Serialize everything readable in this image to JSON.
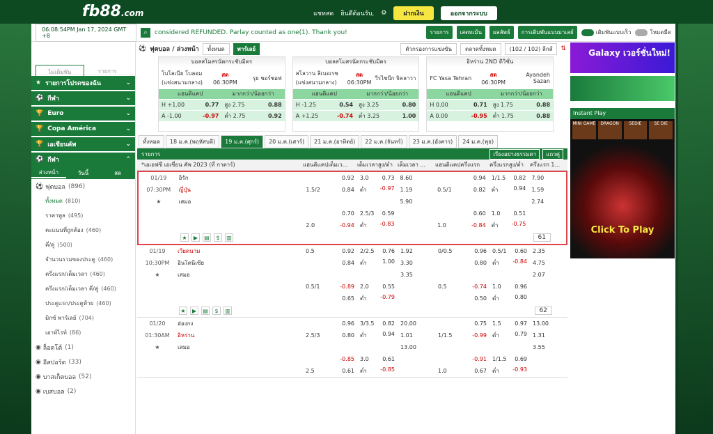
{
  "topbar": {
    "logo": "fb88",
    "logo_suffix": ".com",
    "chat": "แชทสด",
    "welcome": "ยินดีต้อนรับ,",
    "deposit": "ฝากเงิน",
    "logout": "ออกจากระบบ"
  },
  "header": {
    "time": "06:08:54PM Jan 17, 2024 GMT +8",
    "ticker": "considered REFUNDED. Parlay counted as one(1). Thank you!",
    "btn_list": "รายการ",
    "btn_bet": "เสตทเม้น",
    "btn_result": "ผลลัพธ์",
    "btn_type": "การเดิมพันแบบมาเลย์",
    "toggle1": "เดิมพันแบบเร็ว",
    "toggle2": "โหมดมืด"
  },
  "left": {
    "tab_unsettled": "ไม่เดิมพัน",
    "tab_list": "รายการ",
    "cats": [
      "รายการโปรดของฉัน",
      "กีฬา",
      "Euro",
      "Copa América",
      "เอเชียนคัพ",
      "กีฬา"
    ],
    "subtabs": [
      "ล่วงหน้า",
      "วันนี้",
      "สด"
    ],
    "items": [
      {
        "label": "ฟุตบอล",
        "count": "(896)"
      },
      {
        "label": "ทั้งหมด",
        "count": "(810)"
      },
      {
        "label": "ราคาพูล",
        "count": "(495)"
      },
      {
        "label": "คะแนนที่ถูกต้อง",
        "count": "(460)"
      },
      {
        "label": "คี่/คู่",
        "count": "(500)"
      },
      {
        "label": "จำนวนรวมของประตู",
        "count": "(460)"
      },
      {
        "label": "ครึ่งแรก/เต็มเวลา",
        "count": "(460)"
      },
      {
        "label": "ครึ่งแรก/เต็มเวลา คี่/คู่",
        "count": "(460)"
      },
      {
        "label": "ประตูแรก/ประตูท้าย",
        "count": "(460)"
      },
      {
        "label": "มิกซ์ พาร์เลย์",
        "count": "(704)"
      },
      {
        "label": "เอาท์ไรท์",
        "count": "(86)"
      },
      {
        "label": "ล็อตโต้",
        "count": "(1)"
      },
      {
        "label": "อีสปอร์ต",
        "count": "(33)"
      },
      {
        "label": "บาสเก็ตบอล",
        "count": "(52)"
      },
      {
        "label": "เบสบอล",
        "count": "(2)"
      }
    ]
  },
  "center": {
    "sport": "ฟุตบอล / ล่วงหน้า",
    "filter": "ทั้งหมด",
    "parlay": "พาร์เลย์",
    "sort": "ตัวกรองการแข่งขัน",
    "market": "ตลาดทั้งหมด",
    "count": "(102 / 102) ลีกส์",
    "featured": [
      {
        "league": "บอลสโมสรนัดกระชับมิตร",
        "home": "โบโลเนีย โบลอม (แข่งสนามกลาง)",
        "live": "สด",
        "time": "06:30PM",
        "away": "รุย ชอร์ชอฟ",
        "h1": "H +1.00",
        "h2": "0.77",
        "o1": "สูง 2.75",
        "o2": "0.88",
        "a1": "A -1.00",
        "a2": "-0.97",
        "u1": "ต่ำ 2.75",
        "u2": "0.92"
      },
      {
        "league": "บอลสโมสรนัดกระชับมิตร",
        "home": "สโลวาน ลิเบอเรช (แข่งสนามกลาง)",
        "live": "สด",
        "time": "06:30PM",
        "away": "วีรไชบีก จิคลาวา",
        "h1": "H -1.25",
        "h2": "0.54",
        "o1": "สูง 3.25",
        "o2": "0.80",
        "a1": "A +1.25",
        "a2": "-0.74",
        "u1": "ต่ำ 3.25",
        "u2": "1.00"
      },
      {
        "league": "อิหร่าน 2ND ดิวิชั่น",
        "home": "FC Yasa Tehran",
        "live": "สด",
        "time": "06:30PM",
        "away": "Ayandeh Sazan",
        "h1": "H 0.00",
        "h2": "0.71",
        "o1": "สูง 1.75",
        "o2": "0.88",
        "a1": "A 0.00",
        "a2": "-0.95",
        "u1": "ต่ำ 1.75",
        "u2": "0.88"
      }
    ],
    "hcap_label": "แฮนดิแคป",
    "ou_label": "มากกว่า/น้อยกว่า",
    "dates": [
      "ทั้งหมด",
      "18 ม.ค.(พฤหัสบดี)",
      "19 ม.ค.(ศุกร์)",
      "20 ม.ค.(เสาร์)",
      "21 ม.ค.(อาทิตย์)",
      "22 ม.ค.(จันทร์)",
      "23 ม.ค.(อังคาร)",
      "24 ม.ค.(พุธ)"
    ],
    "list_label": "รายการ",
    "order": "เรียงอย่างธรรมดา",
    "view": "แถวคู่",
    "league": "*เอเอฟซี เอเชี่ยน คัพ 2023 (ที่ กาตาร์)",
    "cols": [
      "แฮนดิแคปเต็มเว...",
      "เต็มเวลาสูง/ต่ำ",
      "เต็มเวลา ...",
      "แฮนดิแคปครึ่งแรก",
      "ครึ่งแรกสูง/ต่ำ",
      "ครึ่งแรก 1..."
    ],
    "matches": [
      {
        "date": "01/19",
        "time": "07:30PM",
        "home": "อิรัก",
        "away": "ญี่ปุ่น",
        "draw": "เสมอ",
        "home_red": false,
        "away_red": true,
        "more": "61",
        "rows": [
          [
            "",
            "0.92",
            "3.0",
            "0.73",
            "8.60",
            "",
            "0.94",
            "1/1.5",
            "0.82",
            "7.90"
          ],
          [
            "1.5/2",
            "0.84",
            "ต่ำ",
            "-0.97",
            "1.19",
            "0.5/1",
            "0.82",
            "ต่ำ",
            "0.94",
            "1.59"
          ],
          [
            "",
            "",
            "",
            "",
            "5.90",
            "",
            "",
            "",
            "",
            "2.74"
          ],
          [
            "",
            "0.70",
            "2.5/3",
            "0.59",
            "",
            "",
            "0.60",
            "1.0",
            "0.51",
            ""
          ],
          [
            "2.0",
            "-0.94",
            "ต่ำ",
            "-0.83",
            "",
            "1.0",
            "-0.84",
            "ต่ำ",
            "-0.75",
            ""
          ]
        ]
      },
      {
        "date": "01/19",
        "time": "10:30PM",
        "home": "เวียดนาม",
        "away": "อินโดนีเซีย",
        "draw": "เสมอ",
        "home_red": true,
        "away_red": false,
        "more": "62",
        "rows": [
          [
            "0.5",
            "0.92",
            "2/2.5",
            "0.76",
            "1.92",
            "0/0.5",
            "0.96",
            "0.5/1",
            "0.60",
            "2.35"
          ],
          [
            "",
            "0.84",
            "ต่ำ",
            "1.00",
            "3.30",
            "",
            "0.80",
            "ต่ำ",
            "-0.84",
            "4.75"
          ],
          [
            "",
            "",
            "",
            "",
            "3.35",
            "",
            "",
            "",
            "",
            "2.07"
          ],
          [
            "0.5/1",
            "-0.89",
            "2.0",
            "0.55",
            "",
            "0.5",
            "-0.74",
            "1.0",
            "0.96",
            ""
          ],
          [
            "",
            "0.65",
            "ต่ำ",
            "-0.79",
            "",
            "",
            "0.50",
            "ต่ำ",
            "0.80",
            ""
          ]
        ]
      },
      {
        "date": "01/20",
        "time": "01:30AM",
        "home": "ฮ่องกง",
        "away": "อิหร่าน",
        "draw": "เสมอ",
        "home_red": false,
        "away_red": true,
        "more": "",
        "rows": [
          [
            "",
            "0.96",
            "3/3.5",
            "0.82",
            "20.00",
            "",
            "0.75",
            "1.5",
            "0.97",
            "13.00"
          ],
          [
            "2.5/3",
            "0.80",
            "ต่ำ",
            "0.94",
            "1.01",
            "1/1.5",
            "-0.99",
            "ต่ำ",
            "0.79",
            "1.31"
          ],
          [
            "",
            "",
            "",
            "",
            "13.00",
            "",
            "",
            "",
            "",
            "3.55"
          ],
          [
            "",
            "-0.85",
            "3.0",
            "0.61",
            "",
            "",
            "-0.91",
            "1/1.5",
            "0.69",
            ""
          ],
          [
            "2.5",
            "0.61",
            "ต่ำ",
            "-0.85",
            "",
            "1.0",
            "0.67",
            "ต่ำ",
            "-0.93",
            ""
          ]
        ]
      }
    ]
  },
  "right": {
    "banner": "Galaxy เวอร์ชั่นใหม่!",
    "instant": "Instant Play",
    "games": [
      "MINI GAME",
      "DRAGON",
      "SEDIE",
      "SE DIE"
    ],
    "casino": "Click To Play"
  }
}
